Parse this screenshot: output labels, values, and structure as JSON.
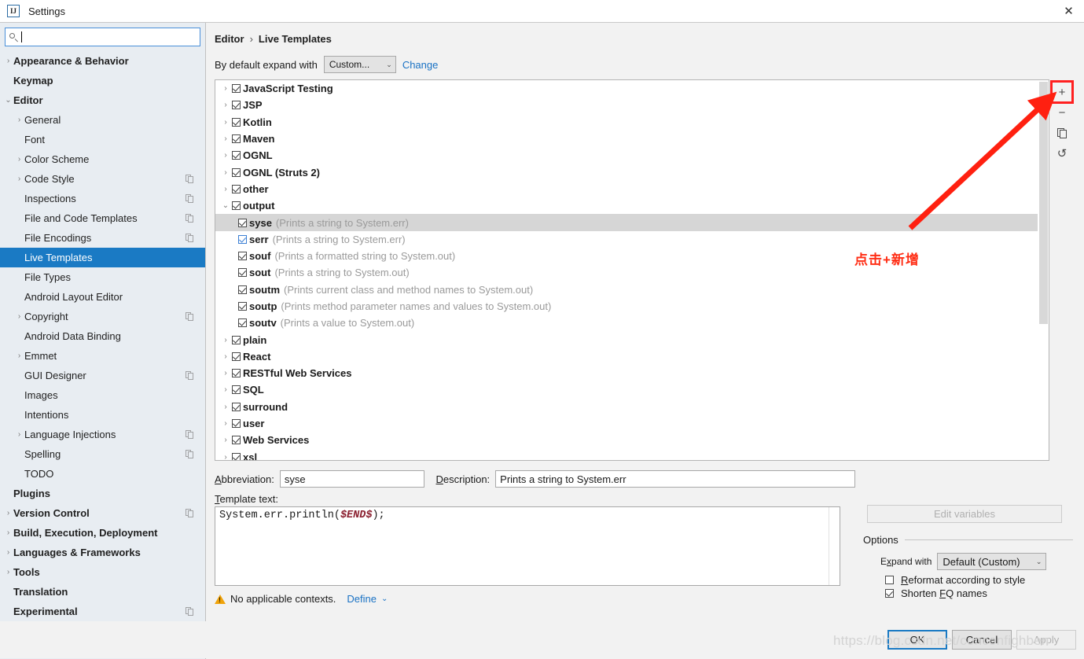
{
  "window": {
    "title": "Settings",
    "app_icon": "intellij-idea-icon",
    "close_label": "✕"
  },
  "search": {
    "value": "",
    "placeholder": ""
  },
  "sidebar": {
    "items": [
      {
        "label": "Appearance & Behavior",
        "arrow": "›",
        "bold": true,
        "indent": 0,
        "copy": false,
        "selected": false
      },
      {
        "label": "Keymap",
        "arrow": "",
        "bold": true,
        "indent": 0,
        "copy": false,
        "selected": false
      },
      {
        "label": "Editor",
        "arrow": "⌄",
        "bold": true,
        "indent": 0,
        "copy": false,
        "selected": false
      },
      {
        "label": "General",
        "arrow": "›",
        "bold": false,
        "indent": 1,
        "copy": false,
        "selected": false
      },
      {
        "label": "Font",
        "arrow": "",
        "bold": false,
        "indent": 1,
        "copy": false,
        "selected": false
      },
      {
        "label": "Color Scheme",
        "arrow": "›",
        "bold": false,
        "indent": 1,
        "copy": false,
        "selected": false
      },
      {
        "label": "Code Style",
        "arrow": "›",
        "bold": false,
        "indent": 1,
        "copy": true,
        "selected": false
      },
      {
        "label": "Inspections",
        "arrow": "",
        "bold": false,
        "indent": 1,
        "copy": true,
        "selected": false
      },
      {
        "label": "File and Code Templates",
        "arrow": "",
        "bold": false,
        "indent": 1,
        "copy": true,
        "selected": false
      },
      {
        "label": "File Encodings",
        "arrow": "",
        "bold": false,
        "indent": 1,
        "copy": true,
        "selected": false
      },
      {
        "label": "Live Templates",
        "arrow": "",
        "bold": false,
        "indent": 1,
        "copy": false,
        "selected": true
      },
      {
        "label": "File Types",
        "arrow": "",
        "bold": false,
        "indent": 1,
        "copy": false,
        "selected": false
      },
      {
        "label": "Android Layout Editor",
        "arrow": "",
        "bold": false,
        "indent": 1,
        "copy": false,
        "selected": false
      },
      {
        "label": "Copyright",
        "arrow": "›",
        "bold": false,
        "indent": 1,
        "copy": true,
        "selected": false
      },
      {
        "label": "Android Data Binding",
        "arrow": "",
        "bold": false,
        "indent": 1,
        "copy": false,
        "selected": false
      },
      {
        "label": "Emmet",
        "arrow": "›",
        "bold": false,
        "indent": 1,
        "copy": false,
        "selected": false
      },
      {
        "label": "GUI Designer",
        "arrow": "",
        "bold": false,
        "indent": 1,
        "copy": true,
        "selected": false
      },
      {
        "label": "Images",
        "arrow": "",
        "bold": false,
        "indent": 1,
        "copy": false,
        "selected": false
      },
      {
        "label": "Intentions",
        "arrow": "",
        "bold": false,
        "indent": 1,
        "copy": false,
        "selected": false
      },
      {
        "label": "Language Injections",
        "arrow": "›",
        "bold": false,
        "indent": 1,
        "copy": true,
        "selected": false
      },
      {
        "label": "Spelling",
        "arrow": "",
        "bold": false,
        "indent": 1,
        "copy": true,
        "selected": false
      },
      {
        "label": "TODO",
        "arrow": "",
        "bold": false,
        "indent": 1,
        "copy": false,
        "selected": false
      },
      {
        "label": "Plugins",
        "arrow": "",
        "bold": true,
        "indent": 0,
        "copy": false,
        "selected": false
      },
      {
        "label": "Version Control",
        "arrow": "›",
        "bold": true,
        "indent": 0,
        "copy": true,
        "selected": false
      },
      {
        "label": "Build, Execution, Deployment",
        "arrow": "›",
        "bold": true,
        "indent": 0,
        "copy": false,
        "selected": false
      },
      {
        "label": "Languages & Frameworks",
        "arrow": "›",
        "bold": true,
        "indent": 0,
        "copy": false,
        "selected": false
      },
      {
        "label": "Tools",
        "arrow": "›",
        "bold": true,
        "indent": 0,
        "copy": false,
        "selected": false
      },
      {
        "label": "Translation",
        "arrow": "",
        "bold": true,
        "indent": 0,
        "copy": false,
        "selected": false
      },
      {
        "label": "Experimental",
        "arrow": "",
        "bold": true,
        "indent": 0,
        "copy": true,
        "selected": false
      }
    ],
    "help_label": "?"
  },
  "main": {
    "breadcrumb": {
      "parent": "Editor",
      "separator": "›",
      "current": "Live Templates"
    },
    "expand_row": {
      "label": "By default expand with",
      "combo_value": "Custom...",
      "chevron": "⌄",
      "change_link": "Change"
    },
    "tree": [
      {
        "type": "group",
        "arrow": "›",
        "label": "JavaScript Testing",
        "checked": true
      },
      {
        "type": "group",
        "arrow": "›",
        "label": "JSP",
        "checked": true
      },
      {
        "type": "group",
        "arrow": "›",
        "label": "Kotlin",
        "checked": true
      },
      {
        "type": "group",
        "arrow": "›",
        "label": "Maven",
        "checked": true
      },
      {
        "type": "group",
        "arrow": "›",
        "label": "OGNL",
        "checked": true
      },
      {
        "type": "group",
        "arrow": "›",
        "label": "OGNL (Struts 2)",
        "checked": true
      },
      {
        "type": "group",
        "arrow": "›",
        "label": "other",
        "checked": true
      },
      {
        "type": "group",
        "arrow": "⌄",
        "label": "output",
        "checked": true
      },
      {
        "type": "leaf",
        "abbr": "syse",
        "desc": "(Prints a string to System.err)",
        "checked": true,
        "selected": true,
        "blue": false
      },
      {
        "type": "leaf",
        "abbr": "serr",
        "desc": "(Prints a string to System.err)",
        "checked": true,
        "selected": false,
        "blue": true
      },
      {
        "type": "leaf",
        "abbr": "souf",
        "desc": "(Prints a formatted string to System.out)",
        "checked": true,
        "selected": false,
        "blue": false
      },
      {
        "type": "leaf",
        "abbr": "sout",
        "desc": "(Prints a string to System.out)",
        "checked": true,
        "selected": false,
        "blue": false
      },
      {
        "type": "leaf",
        "abbr": "soutm",
        "desc": "(Prints current class and method names to System.out)",
        "checked": true,
        "selected": false,
        "blue": false
      },
      {
        "type": "leaf",
        "abbr": "soutp",
        "desc": "(Prints method parameter names and values to System.out)",
        "checked": true,
        "selected": false,
        "blue": false
      },
      {
        "type": "leaf",
        "abbr": "soutv",
        "desc": "(Prints a value to System.out)",
        "checked": true,
        "selected": false,
        "blue": false
      },
      {
        "type": "group",
        "arrow": "›",
        "label": "plain",
        "checked": true
      },
      {
        "type": "group",
        "arrow": "›",
        "label": "React",
        "checked": true
      },
      {
        "type": "group",
        "arrow": "›",
        "label": "RESTful Web Services",
        "checked": true
      },
      {
        "type": "group",
        "arrow": "›",
        "label": "SQL",
        "checked": true
      },
      {
        "type": "group",
        "arrow": "›",
        "label": "surround",
        "checked": true
      },
      {
        "type": "group",
        "arrow": "›",
        "label": "user",
        "checked": true
      },
      {
        "type": "group",
        "arrow": "›",
        "label": "Web Services",
        "checked": true
      },
      {
        "type": "group",
        "arrow": "›",
        "label": "xsl",
        "checked": true
      }
    ],
    "toolbar": {
      "add": "+",
      "remove": "−",
      "duplicate": "duplicate-icon",
      "reset": "↺"
    }
  },
  "form": {
    "abbreviation_label": "Abbreviation:",
    "abbreviation_value": "syse",
    "description_label": "Description:",
    "description_value": "Prints a string to System.err",
    "template_text_label": "Template text:",
    "template_code_prefix": "System.err.println(",
    "template_code_var": "$END$",
    "template_code_suffix": ");",
    "edit_variables_label": "Edit variables",
    "context_warning": "No applicable contexts.",
    "define_link": "Define",
    "define_chevron": "⌄"
  },
  "options": {
    "legend": "Options",
    "expand_with_label": "Expand with",
    "expand_with_value": "Default (Custom)",
    "chevron": "⌄",
    "reformat_label": "Reformat according to style",
    "reformat_checked": false,
    "shorten_label": "Shorten FQ names",
    "shorten_checked": true
  },
  "footer": {
    "ok": "OK",
    "cancel": "Cancel",
    "apply": "Apply"
  },
  "annotation": {
    "text": "点击+新增",
    "color": "#ff2d14"
  },
  "watermark": {
    "text": "https://blog.csdn.net/conconfighben"
  }
}
